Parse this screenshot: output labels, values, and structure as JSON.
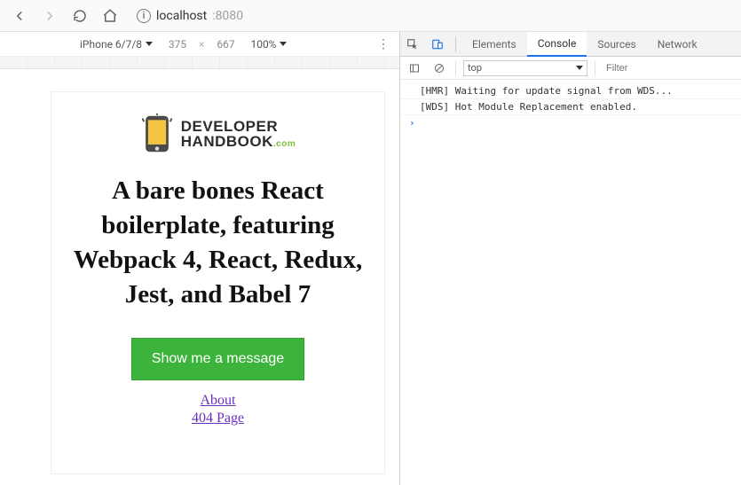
{
  "browser": {
    "url_host": "localhost",
    "url_port": ":8080"
  },
  "device_toolbar": {
    "device": "iPhone 6/7/8",
    "width": "375",
    "height": "667",
    "dim_sep": "×",
    "zoom": "100%",
    "menu_glyph": "⋮"
  },
  "page": {
    "logo": {
      "line1": "DEVELOPER",
      "line2": "HANDBOOK",
      "suffix": ".com"
    },
    "headline": "A bare bones React boilerplate, featuring Webpack 4, React, Redux, Jest, and Babel 7",
    "cta": "Show me a message",
    "links": {
      "about": "About",
      "notfound": "404 Page"
    }
  },
  "devtools": {
    "tabs": {
      "elements": "Elements",
      "console": "Console",
      "sources": "Sources",
      "network": "Network"
    },
    "context": "top",
    "filter_placeholder": "Filter",
    "lines": [
      "[HMR] Waiting for update signal from WDS...",
      "[WDS] Hot Module Replacement enabled."
    ],
    "prompt": "›"
  }
}
